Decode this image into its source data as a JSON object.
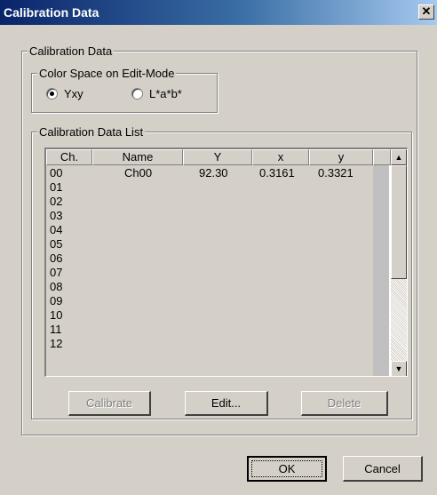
{
  "window": {
    "title": "Calibration Data",
    "close_glyph": "✕"
  },
  "calibration_group": {
    "label": "Calibration Data"
  },
  "color_space": {
    "label": "Color Space on Edit-Mode",
    "options": [
      {
        "label": "Yxy",
        "selected": true
      },
      {
        "label": "L*a*b*",
        "selected": false
      }
    ]
  },
  "list": {
    "label": "Calibration Data List",
    "columns": [
      "Ch.",
      "Name",
      "Y",
      "x",
      "y"
    ],
    "rows": [
      {
        "ch": "00",
        "name": "Ch00",
        "Y": "92.30",
        "x": "0.3161",
        "y": "0.3321"
      },
      {
        "ch": "01",
        "name": "",
        "Y": "",
        "x": "",
        "y": ""
      },
      {
        "ch": "02",
        "name": "",
        "Y": "",
        "x": "",
        "y": ""
      },
      {
        "ch": "03",
        "name": "",
        "Y": "",
        "x": "",
        "y": ""
      },
      {
        "ch": "04",
        "name": "",
        "Y": "",
        "x": "",
        "y": ""
      },
      {
        "ch": "05",
        "name": "",
        "Y": "",
        "x": "",
        "y": ""
      },
      {
        "ch": "06",
        "name": "",
        "Y": "",
        "x": "",
        "y": ""
      },
      {
        "ch": "07",
        "name": "",
        "Y": "",
        "x": "",
        "y": ""
      },
      {
        "ch": "08",
        "name": "",
        "Y": "",
        "x": "",
        "y": ""
      },
      {
        "ch": "09",
        "name": "",
        "Y": "",
        "x": "",
        "y": ""
      },
      {
        "ch": "10",
        "name": "",
        "Y": "",
        "x": "",
        "y": ""
      },
      {
        "ch": "11",
        "name": "",
        "Y": "",
        "x": "",
        "y": ""
      },
      {
        "ch": "12",
        "name": "",
        "Y": "",
        "x": "",
        "y": ""
      }
    ],
    "scroll_up_icon": "▲",
    "scroll_down_icon": "▼"
  },
  "actions": {
    "calibrate": "Calibrate",
    "edit": "Edit...",
    "delete": "Delete"
  },
  "footer": {
    "ok": "OK",
    "cancel": "Cancel"
  },
  "colors": {
    "face": "#d4d0c8",
    "title_start": "#0a246a",
    "title_end": "#a6caf0",
    "disabled_text": "#808080"
  }
}
